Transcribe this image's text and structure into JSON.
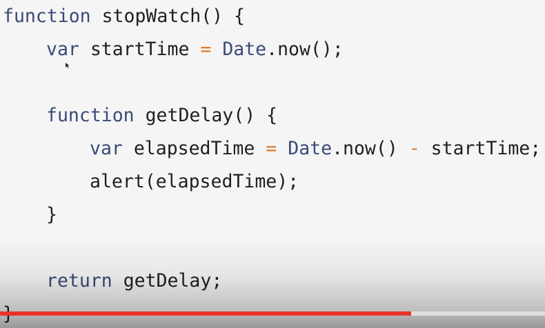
{
  "code": {
    "line1": {
      "kw": "function",
      "name": " stopWatch",
      "rest": "() {"
    },
    "line2": {
      "kw": "var",
      "name": " startTime ",
      "op": "=",
      "sp": " ",
      "cls": "Date",
      "rest": ".now();"
    },
    "line4": {
      "kw": "function",
      "name": " getDelay",
      "rest": "() {"
    },
    "line5": {
      "kw": "var",
      "name": " elapsedTime ",
      "op1": "=",
      "sp": " ",
      "cls": "Date",
      "mid": ".now() ",
      "op2": "-",
      "rest": " startTime;"
    },
    "line6": {
      "text": "alert(elapsedTime);"
    },
    "line7": {
      "text": "}"
    },
    "line9": {
      "kw": "return",
      "rest": " getDelay;"
    },
    "line10": {
      "text": "}"
    }
  },
  "player": {
    "progress": 0.755,
    "progress_color": "#e8322b"
  },
  "colors": {
    "keyword": "#3a4a78",
    "operator": "#e07b2c",
    "text": "#1f1f1f",
    "background": "#f5f5f5"
  }
}
